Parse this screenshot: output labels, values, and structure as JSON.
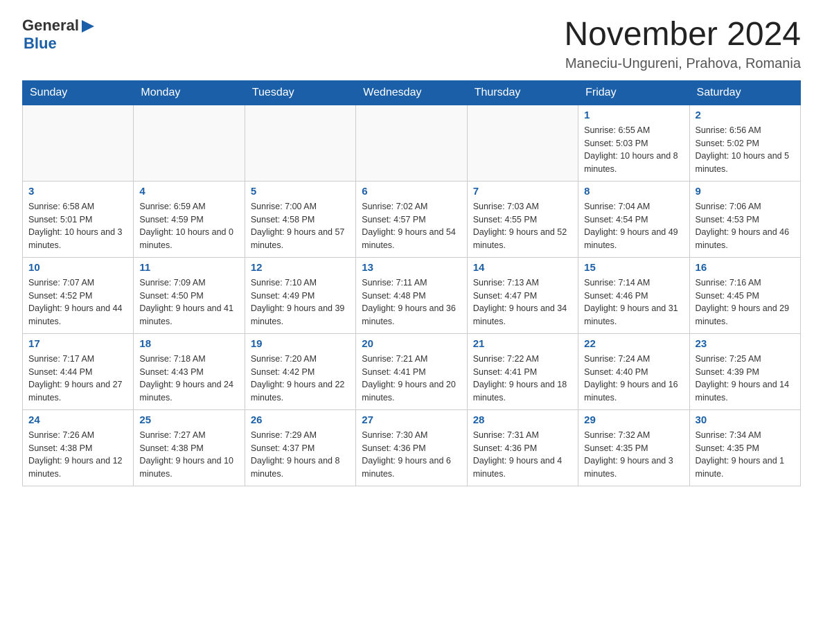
{
  "logo": {
    "text_general": "General",
    "triangle": "▶",
    "text_blue": "Blue"
  },
  "title": "November 2024",
  "location": "Maneciu-Ungureni, Prahova, Romania",
  "days_of_week": [
    "Sunday",
    "Monday",
    "Tuesday",
    "Wednesday",
    "Thursday",
    "Friday",
    "Saturday"
  ],
  "weeks": [
    [
      {
        "day": "",
        "sunrise": "",
        "sunset": "",
        "daylight": ""
      },
      {
        "day": "",
        "sunrise": "",
        "sunset": "",
        "daylight": ""
      },
      {
        "day": "",
        "sunrise": "",
        "sunset": "",
        "daylight": ""
      },
      {
        "day": "",
        "sunrise": "",
        "sunset": "",
        "daylight": ""
      },
      {
        "day": "",
        "sunrise": "",
        "sunset": "",
        "daylight": ""
      },
      {
        "day": "1",
        "sunrise": "Sunrise: 6:55 AM",
        "sunset": "Sunset: 5:03 PM",
        "daylight": "Daylight: 10 hours and 8 minutes."
      },
      {
        "day": "2",
        "sunrise": "Sunrise: 6:56 AM",
        "sunset": "Sunset: 5:02 PM",
        "daylight": "Daylight: 10 hours and 5 minutes."
      }
    ],
    [
      {
        "day": "3",
        "sunrise": "Sunrise: 6:58 AM",
        "sunset": "Sunset: 5:01 PM",
        "daylight": "Daylight: 10 hours and 3 minutes."
      },
      {
        "day": "4",
        "sunrise": "Sunrise: 6:59 AM",
        "sunset": "Sunset: 4:59 PM",
        "daylight": "Daylight: 10 hours and 0 minutes."
      },
      {
        "day": "5",
        "sunrise": "Sunrise: 7:00 AM",
        "sunset": "Sunset: 4:58 PM",
        "daylight": "Daylight: 9 hours and 57 minutes."
      },
      {
        "day": "6",
        "sunrise": "Sunrise: 7:02 AM",
        "sunset": "Sunset: 4:57 PM",
        "daylight": "Daylight: 9 hours and 54 minutes."
      },
      {
        "day": "7",
        "sunrise": "Sunrise: 7:03 AM",
        "sunset": "Sunset: 4:55 PM",
        "daylight": "Daylight: 9 hours and 52 minutes."
      },
      {
        "day": "8",
        "sunrise": "Sunrise: 7:04 AM",
        "sunset": "Sunset: 4:54 PM",
        "daylight": "Daylight: 9 hours and 49 minutes."
      },
      {
        "day": "9",
        "sunrise": "Sunrise: 7:06 AM",
        "sunset": "Sunset: 4:53 PM",
        "daylight": "Daylight: 9 hours and 46 minutes."
      }
    ],
    [
      {
        "day": "10",
        "sunrise": "Sunrise: 7:07 AM",
        "sunset": "Sunset: 4:52 PM",
        "daylight": "Daylight: 9 hours and 44 minutes."
      },
      {
        "day": "11",
        "sunrise": "Sunrise: 7:09 AM",
        "sunset": "Sunset: 4:50 PM",
        "daylight": "Daylight: 9 hours and 41 minutes."
      },
      {
        "day": "12",
        "sunrise": "Sunrise: 7:10 AM",
        "sunset": "Sunset: 4:49 PM",
        "daylight": "Daylight: 9 hours and 39 minutes."
      },
      {
        "day": "13",
        "sunrise": "Sunrise: 7:11 AM",
        "sunset": "Sunset: 4:48 PM",
        "daylight": "Daylight: 9 hours and 36 minutes."
      },
      {
        "day": "14",
        "sunrise": "Sunrise: 7:13 AM",
        "sunset": "Sunset: 4:47 PM",
        "daylight": "Daylight: 9 hours and 34 minutes."
      },
      {
        "day": "15",
        "sunrise": "Sunrise: 7:14 AM",
        "sunset": "Sunset: 4:46 PM",
        "daylight": "Daylight: 9 hours and 31 minutes."
      },
      {
        "day": "16",
        "sunrise": "Sunrise: 7:16 AM",
        "sunset": "Sunset: 4:45 PM",
        "daylight": "Daylight: 9 hours and 29 minutes."
      }
    ],
    [
      {
        "day": "17",
        "sunrise": "Sunrise: 7:17 AM",
        "sunset": "Sunset: 4:44 PM",
        "daylight": "Daylight: 9 hours and 27 minutes."
      },
      {
        "day": "18",
        "sunrise": "Sunrise: 7:18 AM",
        "sunset": "Sunset: 4:43 PM",
        "daylight": "Daylight: 9 hours and 24 minutes."
      },
      {
        "day": "19",
        "sunrise": "Sunrise: 7:20 AM",
        "sunset": "Sunset: 4:42 PM",
        "daylight": "Daylight: 9 hours and 22 minutes."
      },
      {
        "day": "20",
        "sunrise": "Sunrise: 7:21 AM",
        "sunset": "Sunset: 4:41 PM",
        "daylight": "Daylight: 9 hours and 20 minutes."
      },
      {
        "day": "21",
        "sunrise": "Sunrise: 7:22 AM",
        "sunset": "Sunset: 4:41 PM",
        "daylight": "Daylight: 9 hours and 18 minutes."
      },
      {
        "day": "22",
        "sunrise": "Sunrise: 7:24 AM",
        "sunset": "Sunset: 4:40 PM",
        "daylight": "Daylight: 9 hours and 16 minutes."
      },
      {
        "day": "23",
        "sunrise": "Sunrise: 7:25 AM",
        "sunset": "Sunset: 4:39 PM",
        "daylight": "Daylight: 9 hours and 14 minutes."
      }
    ],
    [
      {
        "day": "24",
        "sunrise": "Sunrise: 7:26 AM",
        "sunset": "Sunset: 4:38 PM",
        "daylight": "Daylight: 9 hours and 12 minutes."
      },
      {
        "day": "25",
        "sunrise": "Sunrise: 7:27 AM",
        "sunset": "Sunset: 4:38 PM",
        "daylight": "Daylight: 9 hours and 10 minutes."
      },
      {
        "day": "26",
        "sunrise": "Sunrise: 7:29 AM",
        "sunset": "Sunset: 4:37 PM",
        "daylight": "Daylight: 9 hours and 8 minutes."
      },
      {
        "day": "27",
        "sunrise": "Sunrise: 7:30 AM",
        "sunset": "Sunset: 4:36 PM",
        "daylight": "Daylight: 9 hours and 6 minutes."
      },
      {
        "day": "28",
        "sunrise": "Sunrise: 7:31 AM",
        "sunset": "Sunset: 4:36 PM",
        "daylight": "Daylight: 9 hours and 4 minutes."
      },
      {
        "day": "29",
        "sunrise": "Sunrise: 7:32 AM",
        "sunset": "Sunset: 4:35 PM",
        "daylight": "Daylight: 9 hours and 3 minutes."
      },
      {
        "day": "30",
        "sunrise": "Sunrise: 7:34 AM",
        "sunset": "Sunset: 4:35 PM",
        "daylight": "Daylight: 9 hours and 1 minute."
      }
    ]
  ]
}
